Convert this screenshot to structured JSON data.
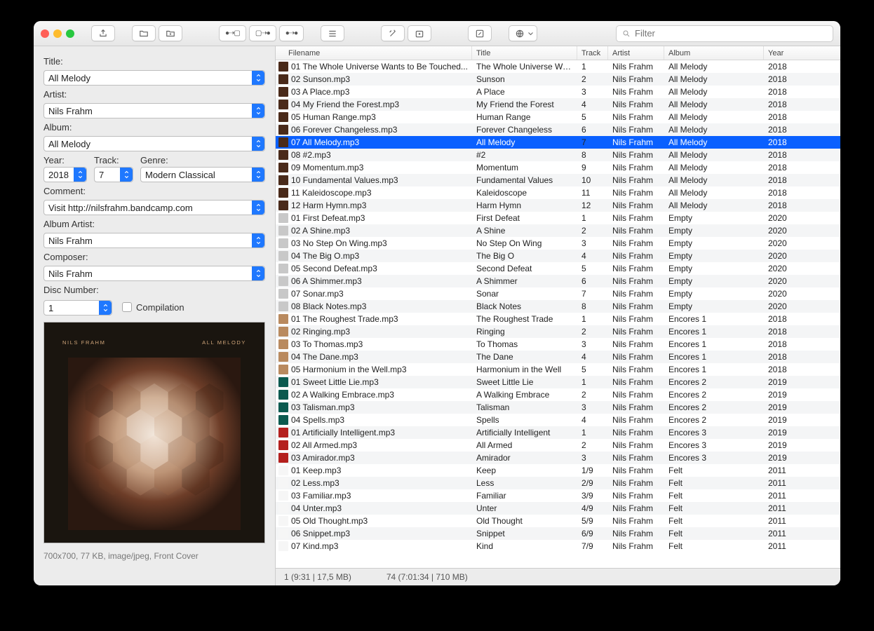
{
  "search_placeholder": "Filter",
  "sidebar": {
    "labels": {
      "title": "Title:",
      "artist": "Artist:",
      "album": "Album:",
      "year": "Year:",
      "track": "Track:",
      "genre": "Genre:",
      "comment": "Comment:",
      "album_artist": "Album Artist:",
      "composer": "Composer:",
      "disc": "Disc Number:",
      "compilation": "Compilation"
    },
    "values": {
      "title": "All Melody",
      "artist": "Nils Frahm",
      "album": "All Melody",
      "year": "2018",
      "track": "7",
      "genre": "Modern Classical",
      "comment": "Visit http://nilsfrahm.bandcamp.com",
      "album_artist": "Nils Frahm",
      "composer": "Nils Frahm",
      "disc": "1"
    },
    "cover_text": {
      "left": "NILS FRAHM",
      "right": "ALL MELODY"
    },
    "cover_meta": "700x700, 77 KB, image/jpeg, Front Cover"
  },
  "columns": {
    "filename": "Filename",
    "title": "Title",
    "track": "Track",
    "artist": "Artist",
    "album": "Album",
    "year": "Year"
  },
  "rows": [
    {
      "fn": "01 The Whole Universe Wants to Be Touched...",
      "ti": "The Whole Universe Wa...",
      "tr": "1",
      "ar": "Nils Frahm",
      "al": "All Melody",
      "yr": "2018",
      "cl": "c1"
    },
    {
      "fn": "02 Sunson.mp3",
      "ti": "Sunson",
      "tr": "2",
      "ar": "Nils Frahm",
      "al": "All Melody",
      "yr": "2018",
      "cl": "c1"
    },
    {
      "fn": "03 A Place.mp3",
      "ti": "A Place",
      "tr": "3",
      "ar": "Nils Frahm",
      "al": "All Melody",
      "yr": "2018",
      "cl": "c1"
    },
    {
      "fn": "04 My Friend the Forest.mp3",
      "ti": "My Friend the Forest",
      "tr": "4",
      "ar": "Nils Frahm",
      "al": "All Melody",
      "yr": "2018",
      "cl": "c1"
    },
    {
      "fn": "05 Human Range.mp3",
      "ti": "Human Range",
      "tr": "5",
      "ar": "Nils Frahm",
      "al": "All Melody",
      "yr": "2018",
      "cl": "c1"
    },
    {
      "fn": "06 Forever Changeless.mp3",
      "ti": "Forever Changeless",
      "tr": "6",
      "ar": "Nils Frahm",
      "al": "All Melody",
      "yr": "2018",
      "cl": "c1"
    },
    {
      "fn": "07 All Melody.mp3",
      "ti": "All Melody",
      "tr": "7",
      "ar": "Nils Frahm",
      "al": "All Melody",
      "yr": "2018",
      "cl": "c1",
      "sel": true
    },
    {
      "fn": "08 #2.mp3",
      "ti": "#2",
      "tr": "8",
      "ar": "Nils Frahm",
      "al": "All Melody",
      "yr": "2018",
      "cl": "c1"
    },
    {
      "fn": "09 Momentum.mp3",
      "ti": "Momentum",
      "tr": "9",
      "ar": "Nils Frahm",
      "al": "All Melody",
      "yr": "2018",
      "cl": "c1"
    },
    {
      "fn": "10 Fundamental Values.mp3",
      "ti": "Fundamental Values",
      "tr": "10",
      "ar": "Nils Frahm",
      "al": "All Melody",
      "yr": "2018",
      "cl": "c1"
    },
    {
      "fn": "11 Kaleidoscope.mp3",
      "ti": "Kaleidoscope",
      "tr": "11",
      "ar": "Nils Frahm",
      "al": "All Melody",
      "yr": "2018",
      "cl": "c1"
    },
    {
      "fn": "12 Harm Hymn.mp3",
      "ti": "Harm Hymn",
      "tr": "12",
      "ar": "Nils Frahm",
      "al": "All Melody",
      "yr": "2018",
      "cl": "c1"
    },
    {
      "fn": "01 First Defeat.mp3",
      "ti": "First Defeat",
      "tr": "1",
      "ar": "Nils Frahm",
      "al": "Empty",
      "yr": "2020",
      "cl": "c2"
    },
    {
      "fn": "02 A Shine.mp3",
      "ti": "A Shine",
      "tr": "2",
      "ar": "Nils Frahm",
      "al": "Empty",
      "yr": "2020",
      "cl": "c2"
    },
    {
      "fn": "03 No Step On Wing.mp3",
      "ti": "No Step On Wing",
      "tr": "3",
      "ar": "Nils Frahm",
      "al": "Empty",
      "yr": "2020",
      "cl": "c2"
    },
    {
      "fn": "04 The Big O.mp3",
      "ti": "The Big O",
      "tr": "4",
      "ar": "Nils Frahm",
      "al": "Empty",
      "yr": "2020",
      "cl": "c2"
    },
    {
      "fn": "05 Second Defeat.mp3",
      "ti": "Second Defeat",
      "tr": "5",
      "ar": "Nils Frahm",
      "al": "Empty",
      "yr": "2020",
      "cl": "c2"
    },
    {
      "fn": "06 A Shimmer.mp3",
      "ti": "A Shimmer",
      "tr": "6",
      "ar": "Nils Frahm",
      "al": "Empty",
      "yr": "2020",
      "cl": "c2"
    },
    {
      "fn": "07 Sonar.mp3",
      "ti": "Sonar",
      "tr": "7",
      "ar": "Nils Frahm",
      "al": "Empty",
      "yr": "2020",
      "cl": "c2"
    },
    {
      "fn": "08 Black Notes.mp3",
      "ti": "Black Notes",
      "tr": "8",
      "ar": "Nils Frahm",
      "al": "Empty",
      "yr": "2020",
      "cl": "c2"
    },
    {
      "fn": "01 The Roughest Trade.mp3",
      "ti": "The Roughest Trade",
      "tr": "1",
      "ar": "Nils Frahm",
      "al": "Encores 1",
      "yr": "2018",
      "cl": "c3"
    },
    {
      "fn": "02 Ringing.mp3",
      "ti": "Ringing",
      "tr": "2",
      "ar": "Nils Frahm",
      "al": "Encores 1",
      "yr": "2018",
      "cl": "c3"
    },
    {
      "fn": "03 To Thomas.mp3",
      "ti": "To Thomas",
      "tr": "3",
      "ar": "Nils Frahm",
      "al": "Encores 1",
      "yr": "2018",
      "cl": "c3"
    },
    {
      "fn": "04 The Dane.mp3",
      "ti": "The Dane",
      "tr": "4",
      "ar": "Nils Frahm",
      "al": "Encores 1",
      "yr": "2018",
      "cl": "c3"
    },
    {
      "fn": "05 Harmonium in the Well.mp3",
      "ti": "Harmonium in the Well",
      "tr": "5",
      "ar": "Nils Frahm",
      "al": "Encores 1",
      "yr": "2018",
      "cl": "c3"
    },
    {
      "fn": "01 Sweet Little Lie.mp3",
      "ti": "Sweet Little Lie",
      "tr": "1",
      "ar": "Nils Frahm",
      "al": "Encores 2",
      "yr": "2019",
      "cl": "c4"
    },
    {
      "fn": "02 A Walking Embrace.mp3",
      "ti": "A Walking Embrace",
      "tr": "2",
      "ar": "Nils Frahm",
      "al": "Encores 2",
      "yr": "2019",
      "cl": "c4"
    },
    {
      "fn": "03 Talisman.mp3",
      "ti": "Talisman",
      "tr": "3",
      "ar": "Nils Frahm",
      "al": "Encores 2",
      "yr": "2019",
      "cl": "c4"
    },
    {
      "fn": "04 Spells.mp3",
      "ti": "Spells",
      "tr": "4",
      "ar": "Nils Frahm",
      "al": "Encores 2",
      "yr": "2019",
      "cl": "c4"
    },
    {
      "fn": "01 Artificially Intelligent.mp3",
      "ti": "Artificially Intelligent",
      "tr": "1",
      "ar": "Nils Frahm",
      "al": "Encores 3",
      "yr": "2019",
      "cl": "c5"
    },
    {
      "fn": "02 All Armed.mp3",
      "ti": "All Armed",
      "tr": "2",
      "ar": "Nils Frahm",
      "al": "Encores 3",
      "yr": "2019",
      "cl": "c5"
    },
    {
      "fn": "03 Amirador.mp3",
      "ti": "Amirador",
      "tr": "3",
      "ar": "Nils Frahm",
      "al": "Encores 3",
      "yr": "2019",
      "cl": "c5"
    },
    {
      "fn": "01 Keep.mp3",
      "ti": "Keep",
      "tr": "1/9",
      "ar": "Nils Frahm",
      "al": "Felt",
      "yr": "2011",
      "cl": "c6"
    },
    {
      "fn": "02 Less.mp3",
      "ti": "Less",
      "tr": "2/9",
      "ar": "Nils Frahm",
      "al": "Felt",
      "yr": "2011",
      "cl": "c6"
    },
    {
      "fn": "03 Familiar.mp3",
      "ti": "Familiar",
      "tr": "3/9",
      "ar": "Nils Frahm",
      "al": "Felt",
      "yr": "2011",
      "cl": "c6"
    },
    {
      "fn": "04 Unter.mp3",
      "ti": "Unter",
      "tr": "4/9",
      "ar": "Nils Frahm",
      "al": "Felt",
      "yr": "2011",
      "cl": "c6"
    },
    {
      "fn": "05 Old Thought.mp3",
      "ti": "Old Thought",
      "tr": "5/9",
      "ar": "Nils Frahm",
      "al": "Felt",
      "yr": "2011",
      "cl": "c6"
    },
    {
      "fn": "06 Snippet.mp3",
      "ti": "Snippet",
      "tr": "6/9",
      "ar": "Nils Frahm",
      "al": "Felt",
      "yr": "2011",
      "cl": "c6"
    },
    {
      "fn": "07 Kind.mp3",
      "ti": "Kind",
      "tr": "7/9",
      "ar": "Nils Frahm",
      "al": "Felt",
      "yr": "2011",
      "cl": "c6"
    }
  ],
  "status": {
    "sel": "1 (9:31 | 17,5 MB)",
    "tot": "74 (7:01:34 | 710 MB)"
  }
}
